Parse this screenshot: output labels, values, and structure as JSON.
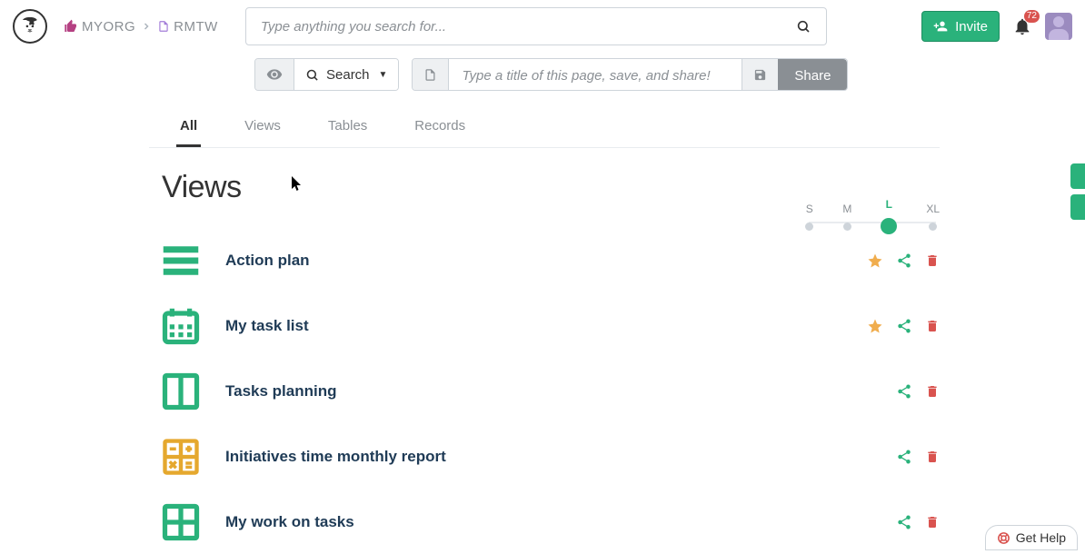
{
  "breadcrumb": {
    "org": "MYORG",
    "page": "RMTW"
  },
  "search": {
    "placeholder": "Type anything you search for..."
  },
  "searchBtn": "Search",
  "titleInput": {
    "placeholder": "Type a title of this page, save, and share!"
  },
  "shareBtn": "Share",
  "invite": {
    "label": "Invite"
  },
  "notifications": {
    "count": "72"
  },
  "tabs": [
    "All",
    "Views",
    "Tables",
    "Records"
  ],
  "activeTab": 0,
  "sectionTitle": "Views",
  "sizes": [
    "S",
    "M",
    "L",
    "XL"
  ],
  "activeSize": 2,
  "views": [
    {
      "title": "Action plan",
      "iconType": "list",
      "iconColor": "#2ab27b",
      "starred": true
    },
    {
      "title": "My task list",
      "iconType": "calendar",
      "iconColor": "#2ab27b",
      "starred": true
    },
    {
      "title": "Tasks planning",
      "iconType": "columns",
      "iconColor": "#2ab27b",
      "starred": false
    },
    {
      "title": "Initiatives time monthly report",
      "iconType": "formula",
      "iconColor": "#e5a82e",
      "starred": false
    },
    {
      "title": "My work on tasks",
      "iconType": "grid2",
      "iconColor": "#2ab27b",
      "starred": false
    }
  ],
  "help": {
    "label": "Get Help"
  }
}
